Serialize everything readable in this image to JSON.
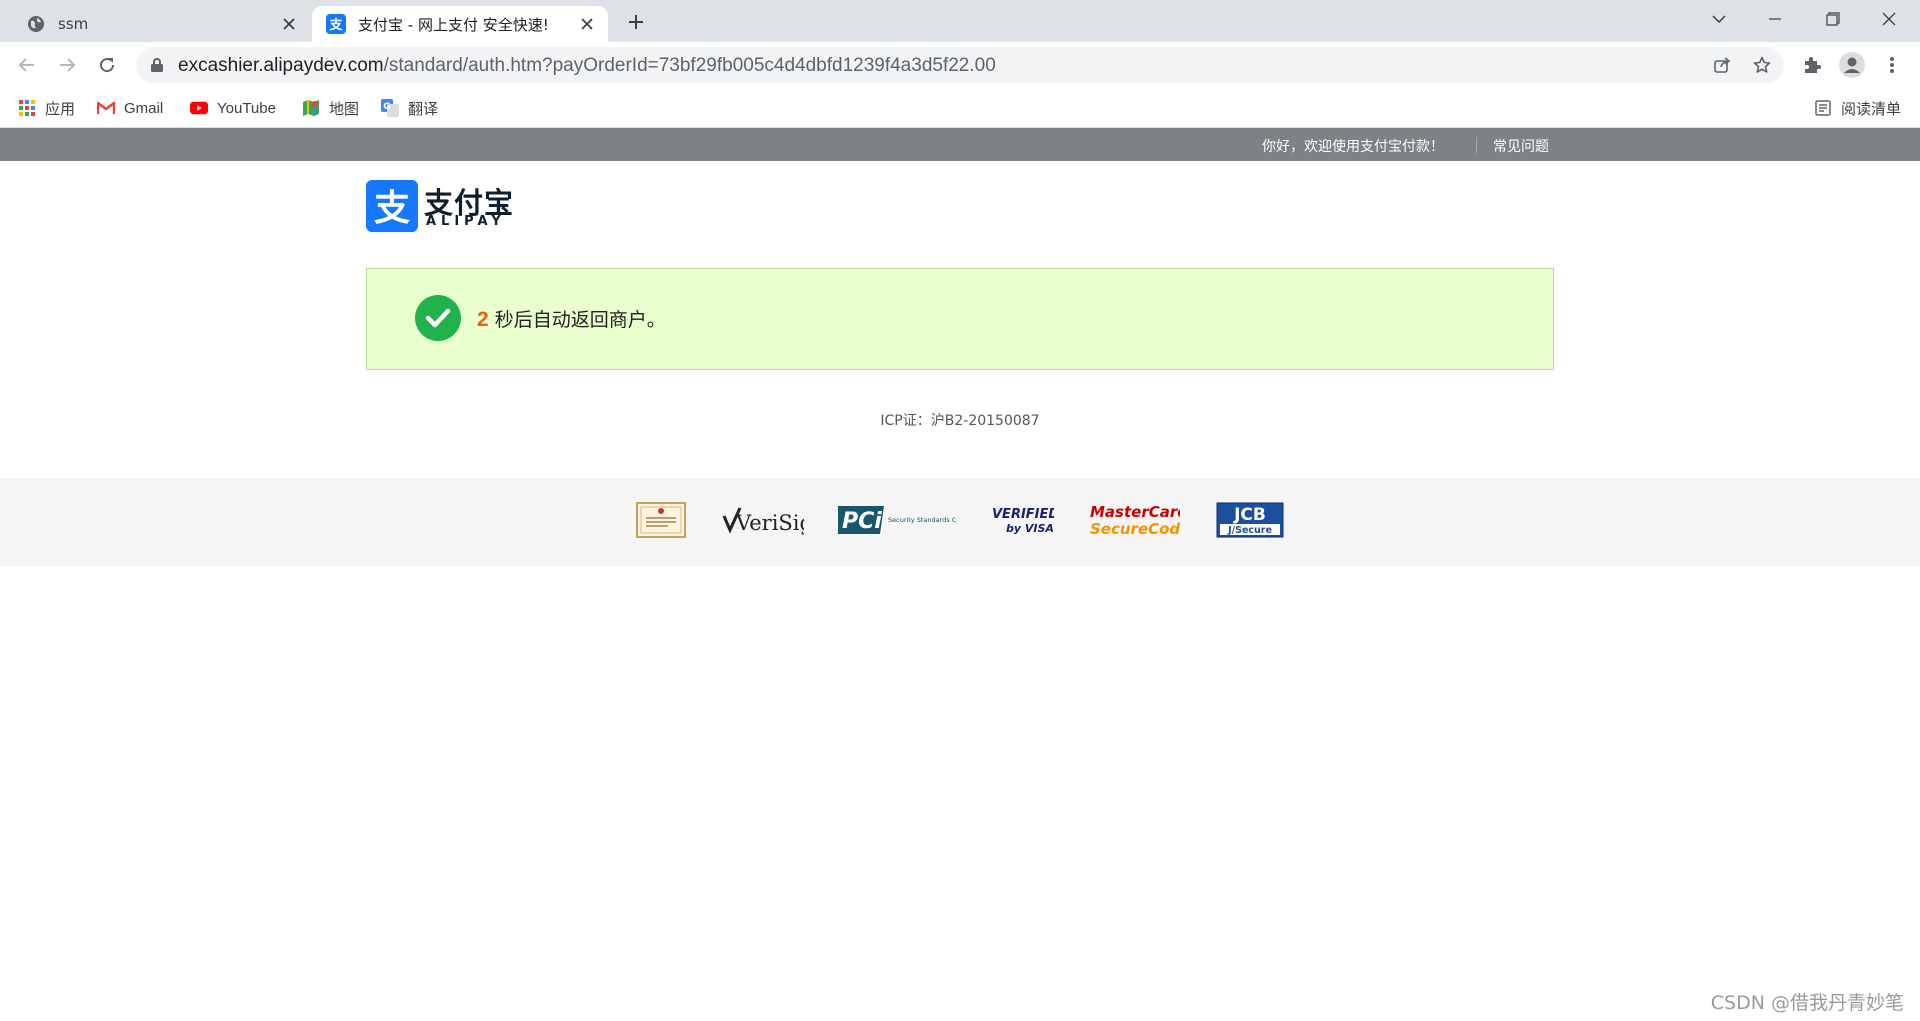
{
  "browser": {
    "tabs": [
      {
        "title": "ssm",
        "favicon": "globe-icon",
        "active": false
      },
      {
        "title": "支付宝 - 网上支付 安全快速!",
        "favicon": "alipay-icon",
        "active": true
      }
    ],
    "address": {
      "host": "excashier.alipaydev.com",
      "path": "/standard/auth.htm?payOrderId=73bf29fb005c4d4dbfd1239f4a3d5f22.00"
    },
    "bookmarks": [
      {
        "label": "应用",
        "icon": "apps-grid-icon"
      },
      {
        "label": "Gmail",
        "icon": "gmail-icon"
      },
      {
        "label": "YouTube",
        "icon": "youtube-icon"
      },
      {
        "label": "地图",
        "icon": "maps-icon"
      },
      {
        "label": "翻译",
        "icon": "translate-icon"
      }
    ],
    "reading_list": "阅读清单"
  },
  "page": {
    "topbar": {
      "welcome": "你好，欢迎使用支付宝付款！",
      "faq": "常见问题"
    },
    "logo": {
      "cn": "支付宝",
      "en": "ALIPAY",
      "icon_char": "支"
    },
    "notice": {
      "seconds": "2",
      "message": "秒后自动返回商户。"
    },
    "icp": "ICP证：沪B2-20150087",
    "certifications": [
      {
        "name": "business-license-badge"
      },
      {
        "name": "verisign-logo",
        "text": "VeriSign"
      },
      {
        "name": "pci-logo",
        "text": "PCi",
        "sub": "Security Standards Council"
      },
      {
        "name": "verified-by-visa-logo",
        "text1": "VERIFIED",
        "text2": "by VISA"
      },
      {
        "name": "mastercard-securecode-logo",
        "text1": "MasterCard.",
        "text2": "SecureCode."
      },
      {
        "name": "jcb-jsecure-logo",
        "text1": "JCB",
        "text2": "J/Secure"
      }
    ]
  },
  "watermark": "CSDN @借我丹青妙笔",
  "colors": {
    "topbar": "#7e8185",
    "notice_bg": "#eaffce",
    "notice_border": "#b8dc95",
    "check_green": "#22b24c",
    "seconds_orange": "#f06200",
    "alipay_blue": "#1677ff"
  }
}
